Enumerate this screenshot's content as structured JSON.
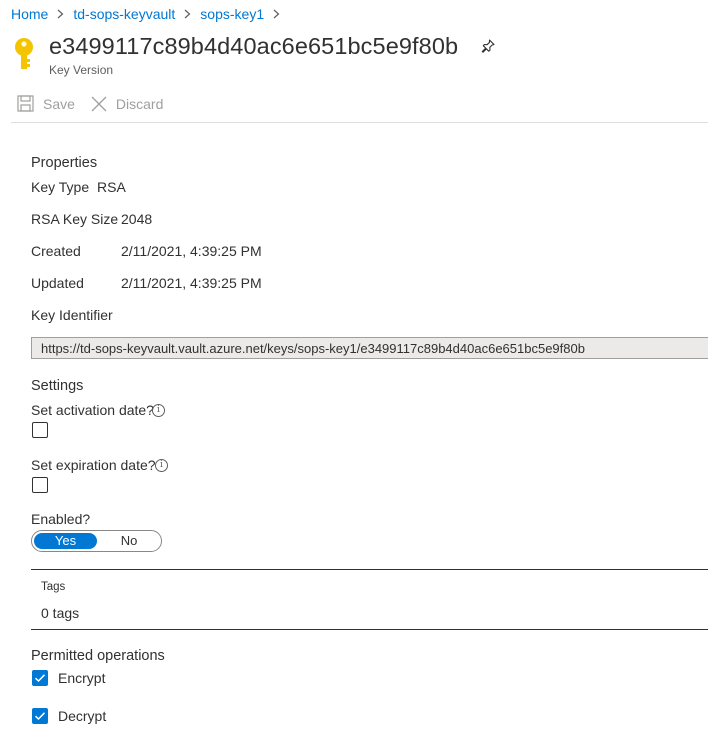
{
  "breadcrumb": {
    "items": [
      "Home",
      "td-sops-keyvault",
      "sops-key1"
    ]
  },
  "header": {
    "title": "e3499117c89b4d40ac6e651bc5e9f80b",
    "subtitle": "Key Version",
    "icon": "key-icon",
    "pin_icon": "pin-icon"
  },
  "toolbar": {
    "save_label": "Save",
    "discard_label": "Discard"
  },
  "properties": {
    "heading": "Properties",
    "key_type_label": "Key Type",
    "key_type_value": "RSA",
    "key_size_label": "RSA Key Size",
    "key_size_value": "2048",
    "created_label": "Created",
    "created_value": "2/11/2021, 4:39:25 PM",
    "updated_label": "Updated",
    "updated_value": "2/11/2021, 4:39:25 PM",
    "key_identifier_label": "Key Identifier",
    "key_identifier_value": "https://td-sops-keyvault.vault.azure.net/keys/sops-key1/e3499117c89b4d40ac6e651bc5e9f80b"
  },
  "settings": {
    "heading": "Settings",
    "activation_label": "Set activation date?",
    "activation_checked": false,
    "expiration_label": "Set expiration date?",
    "expiration_checked": false,
    "info_glyph": "i",
    "enabled_label": "Enabled?",
    "enabled_yes": "Yes",
    "enabled_no": "No",
    "enabled_selected": "Yes"
  },
  "tags": {
    "label": "Tags",
    "value": "0 tags"
  },
  "permitted_operations": {
    "heading": "Permitted operations",
    "items": [
      {
        "label": "Encrypt",
        "checked": true
      },
      {
        "label": "Decrypt",
        "checked": true
      }
    ]
  },
  "colors": {
    "accent": "#0078d4",
    "key_gold": "#f4c400",
    "disabled_text": "#a19f9d"
  }
}
